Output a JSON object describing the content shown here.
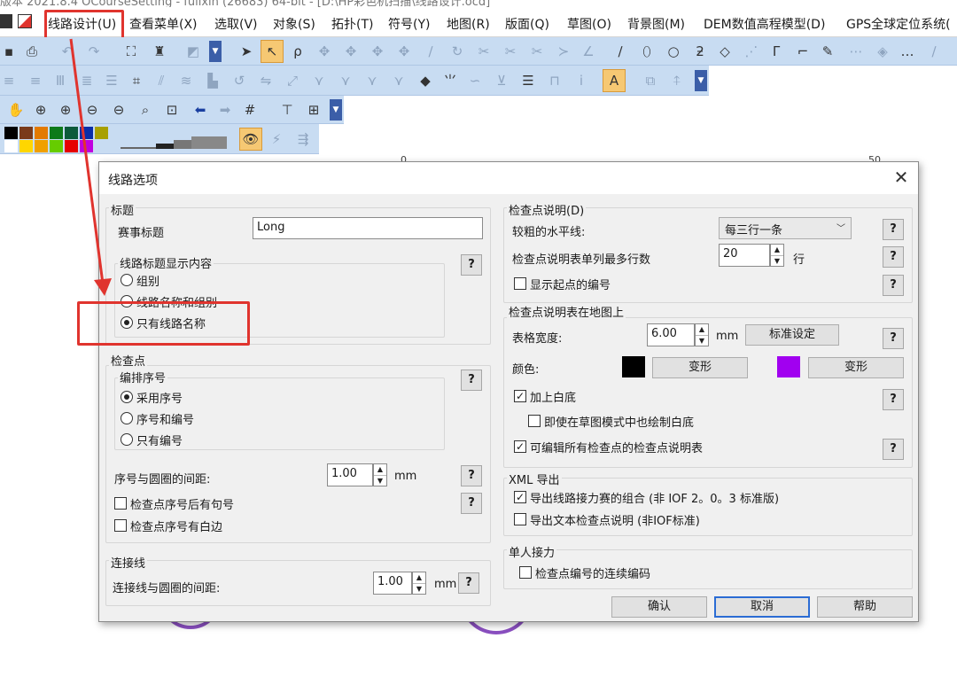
{
  "app": {
    "title": "版本 2021.8.4 OCourseSetting - fullxin (26683) 64-bit - [D:\\HP彩色机扫描\\线路设计.ocd]",
    "menu": [
      "线路设计(U)",
      "查看菜单(X)",
      "选取(V)",
      "对象(S)",
      "拓扑(T)",
      "符号(Y)",
      "地图(R)",
      "版面(Q)",
      "草图(O)",
      "背景图(M)",
      "DEM数值高程模型(D)",
      "GPS全球定位系统("
    ],
    "ruler_marks": [
      "0",
      "50"
    ],
    "colors": {
      "accent_red": "#e0342e",
      "toolbar_bg": "#c8dcf2",
      "highlight_orange": "#f6c873"
    }
  },
  "dialog": {
    "title": "线路选项",
    "title_group": {
      "label": "标题",
      "event_title_label": "赛事标题",
      "event_title_value": "Long",
      "display_group_label": "线路标题显示内容",
      "options": [
        "组别",
        "线路名称和组别",
        "只有线路名称"
      ],
      "selected": 2
    },
    "control_group": {
      "label": "检查点",
      "numbering_label": "编排序号",
      "options": [
        "采用序号",
        "序号和编号",
        "只有编号"
      ],
      "selected": 0,
      "spacing_label": "序号与圆圈的间距:",
      "spacing_value": "1.00",
      "spacing_unit": "mm",
      "period_label": "检查点序号后有句号",
      "period_checked": false,
      "white_edge_label": "检查点序号有白边",
      "white_edge_checked": false
    },
    "connect_group": {
      "label": "连接线",
      "spacing_label": "连接线与圆圈的间距:",
      "spacing_value": "1.00",
      "spacing_unit": "mm"
    },
    "description_group": {
      "label": "检查点说明(D)",
      "thick_line_label": "较粗的水平线:",
      "thick_line_value": "每三行一条",
      "max_rows_label": "检查点说明表单列最多行数",
      "max_rows_value": "20",
      "max_rows_unit": "行",
      "show_start_label": "显示起点的编号",
      "show_start_checked": false
    },
    "map_description_group": {
      "label": "检查点说明表在地图上",
      "width_label": "表格宽度:",
      "width_value": "6.00",
      "width_unit": "mm",
      "standard_button": "标准设定",
      "color_label": "颜色:",
      "color1": "#000000",
      "color2": "#a100f0",
      "transform_button_1": "变形",
      "transform_button_2": "变形",
      "white_bg_label": "加上白底",
      "white_bg_checked": true,
      "draft_white_label": "即使在草图模式中也绘制白底",
      "draft_white_checked": false,
      "editable_label": "可编辑所有检查点的检查点说明表",
      "editable_checked": true
    },
    "xml_group": {
      "label": "XML 导出",
      "relay_label": "导出线路接力赛的组合 (非 IOF 2。0。3 标准版)",
      "relay_checked": true,
      "text_label": "导出文本检查点说明 (非IOF标准)",
      "text_checked": false
    },
    "relay_group": {
      "label": "单人接力",
      "continuous_label": "检查点编号的连续编码",
      "continuous_checked": false
    },
    "help_glyph": "?",
    "close_glyph": "✕",
    "ok_button": "确认",
    "cancel_button": "取消",
    "help_button": "帮助"
  }
}
